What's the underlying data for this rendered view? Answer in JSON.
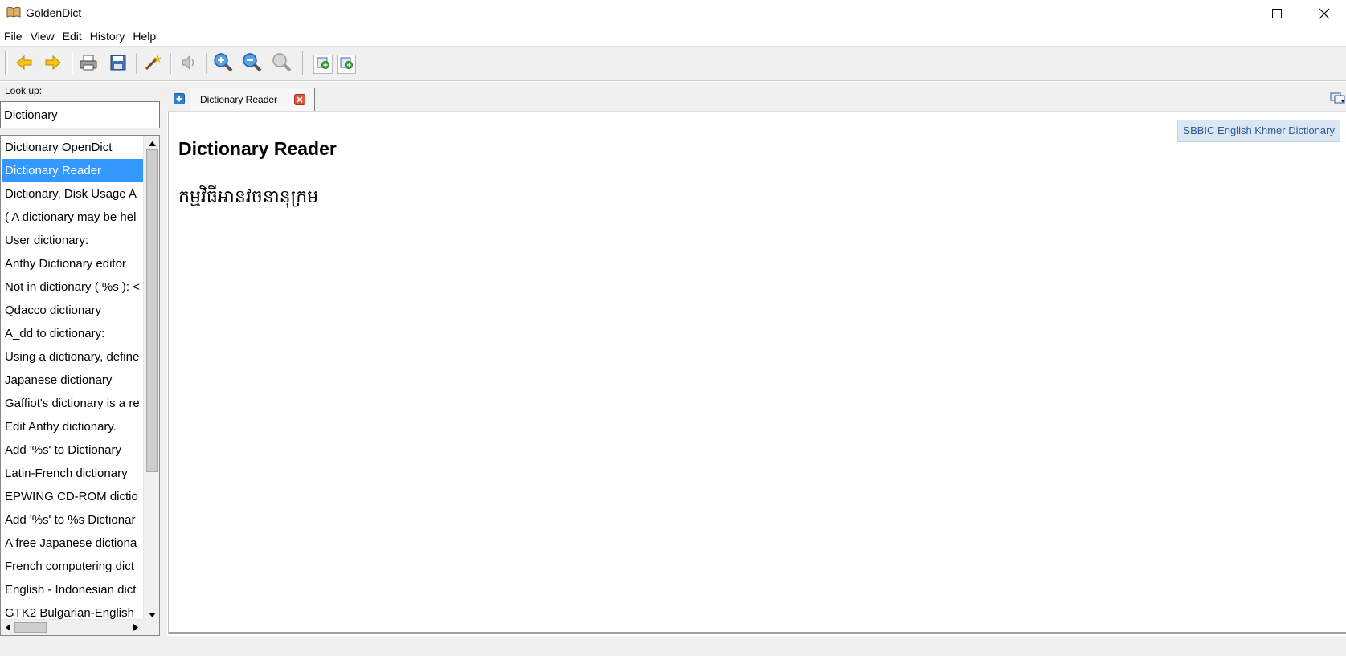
{
  "window": {
    "title": "GoldenDict",
    "minimize_icon": "minimize-icon",
    "maximize_icon": "maximize-icon",
    "close_icon": "close-icon"
  },
  "menu": {
    "items": [
      "File",
      "View",
      "Edit",
      "History",
      "Help"
    ]
  },
  "toolbar": {
    "buttons": [
      "back-arrow-icon",
      "forward-arrow-icon",
      "print-icon",
      "save-icon",
      "scan-popup-wand-icon",
      "pronounce-speaker-icon",
      "zoom-in-icon",
      "zoom-out-icon",
      "zoom-reset-icon",
      "add-to-favorites-icon",
      "favorites-icon"
    ]
  },
  "lookup": {
    "label": "Look up:",
    "value": "Dictionary"
  },
  "word_list": {
    "selected_index": 1,
    "items": [
      "Dictionary OpenDict",
      "Dictionary Reader",
      "Dictionary, Disk Usage A",
      "( A dictionary may be hel",
      "User dictionary:",
      "Anthy Dictionary editor",
      "Not in dictionary ( %s ): <",
      "Qdacco dictionary",
      "A_dd to dictionary:",
      "Using a dictionary, define",
      "Japanese dictionary",
      "Gaffiot's dictionary is a re",
      "Edit Anthy dictionary.",
      "Add '%s' to Dictionary",
      "Latin-French dictionary",
      "EPWING CD-ROM dictio",
      "Add '%s' to %s Dictionar",
      "A free Japanese dictiona",
      "French computering dict",
      "English - Indonesian dict",
      "GTK2 Bulgarian-English"
    ]
  },
  "tabs": {
    "items": [
      {
        "label": "Dictionary Reader"
      }
    ]
  },
  "article": {
    "dictionary_name": "SBBIC English Khmer Dictionary",
    "headword": "Dictionary Reader",
    "definition": "កម្មវិធីអានវចនានុក្រម"
  },
  "colors": {
    "selection": "#3399ff",
    "badge_bg": "#dbe8f3",
    "badge_text": "#2a5a96",
    "tab_close": "#e0553b"
  }
}
